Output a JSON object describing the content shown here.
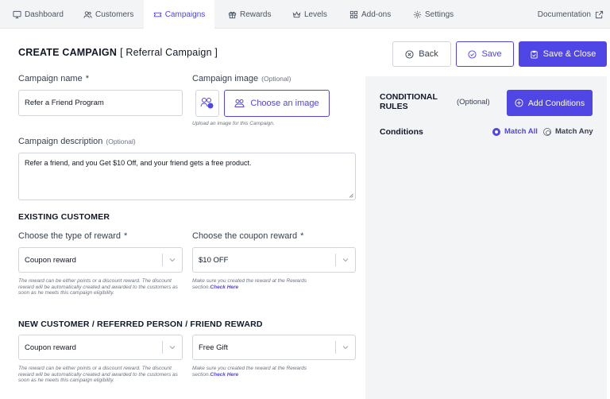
{
  "nav": {
    "tabs": [
      {
        "label": "Dashboard",
        "icon": "monitor-icon"
      },
      {
        "label": "Customers",
        "icon": "users-icon"
      },
      {
        "label": "Campaigns",
        "icon": "ticket-icon",
        "active": true
      },
      {
        "label": "Rewards",
        "icon": "gift-icon"
      },
      {
        "label": "Levels",
        "icon": "crown-icon"
      },
      {
        "label": "Add-ons",
        "icon": "grid-icon"
      },
      {
        "label": "Settings",
        "icon": "gear-icon"
      }
    ],
    "documentation": "Documentation"
  },
  "header": {
    "title": "CREATE CAMPAIGN",
    "subtitle": "[ Referral Campaign ]",
    "back_label": "Back",
    "save_label": "Save",
    "save_close_label": "Save & Close"
  },
  "form": {
    "name_label": "Campaign name",
    "required_mark": "*",
    "name_value": "Refer a Friend Program",
    "image_label": "Campaign image",
    "optional_text": "(Optional)",
    "choose_image_label": "Choose an image",
    "image_help": "Upload an image for this Campaign.",
    "description_label": "Campaign description",
    "description_value": "Refer a friend, and you Get $10 Off, and your friend gets a free product."
  },
  "existing_customer": {
    "title": "EXISTING CUSTOMER",
    "reward_type_label": "Choose the type of reward",
    "reward_type_value": "Coupon reward",
    "reward_type_help": "The reward can be either points or a discount reward. The discount reward will be automatically created and awarded to the customers as soon as he meets this campaign eligibility.",
    "coupon_label": "Choose the coupon reward",
    "coupon_value": "$10 OFF",
    "coupon_help": "Make sure you created the reward at the Rewards section.",
    "check_here": "Check Here"
  },
  "new_customer": {
    "title": "NEW CUSTOMER / REFERRED PERSON / FRIEND REWARD",
    "reward_type_value": "Coupon reward",
    "reward_type_help": "The reward can be either points or a discount reward. The discount reward will be automatically created and awarded to the customers as soon as he meets this campaign eligibility.",
    "coupon_value": "Free Gift",
    "coupon_help": "Make sure you created the reward at the Rewards section.",
    "check_here": "Check Here"
  },
  "conditional_rules": {
    "title": "CONDITIONAL RULES",
    "optional_text": "(Optional)",
    "add_label": "Add Conditions",
    "conditions_label": "Conditions",
    "match_all": "Match All",
    "match_any": "Match Any",
    "selected": "Match All"
  },
  "colors": {
    "accent": "#4f46e5",
    "panel_bg": "#f3f4f6",
    "border": "#d1d5db"
  }
}
